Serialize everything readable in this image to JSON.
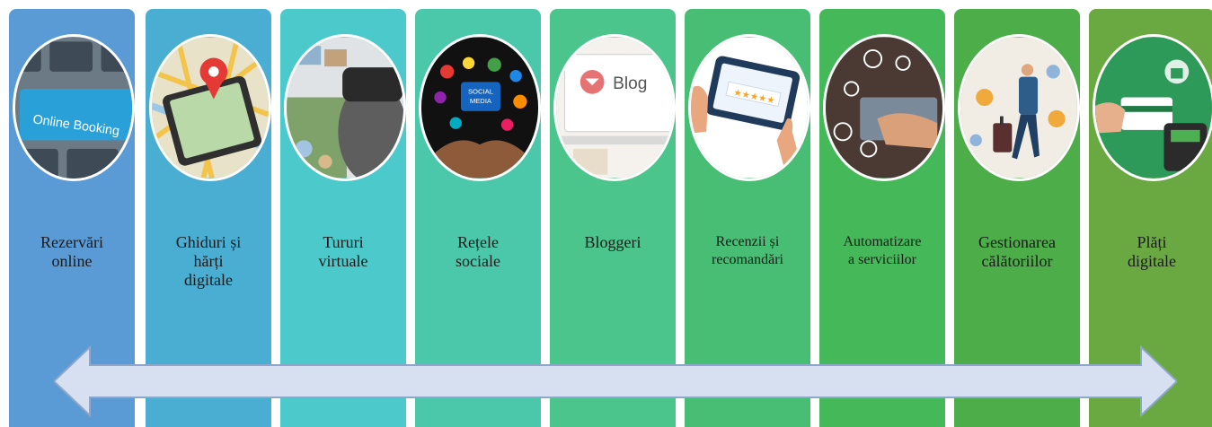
{
  "stages": [
    {
      "label": "Rezervări\nonline",
      "color": "#5b9bd5",
      "icon": "online-booking-keyboard"
    },
    {
      "label": "Ghiduri și\nhărți\ndigitale",
      "color": "#4aaed3",
      "icon": "smartphone-map-pin"
    },
    {
      "label": "Tururi\nvirtuale",
      "color": "#4cc9cb",
      "icon": "vr-headset"
    },
    {
      "label": "Rețele\nsociale",
      "color": "#4ac8a9",
      "icon": "social-media-hands"
    },
    {
      "label": "Bloggeri",
      "color": "#4bc58c",
      "icon": "blog-laptop"
    },
    {
      "label": "Recenzii și\nrecomandări",
      "color": "#48be74",
      "icon": "rating-tablet"
    },
    {
      "label": "Automatizare\na serviciilor",
      "color": "#45b95a",
      "icon": "automation-hands"
    },
    {
      "label": "Gestionarea\ncălătoriilor",
      "color": "#4cad49",
      "icon": "traveler-luggage"
    },
    {
      "label": "Plăți\ndigitale",
      "color": "#6aa842",
      "icon": "digital-payment-card"
    }
  ],
  "booking_key_text": "Online Booking",
  "social_badge_text": "SOCIAL\nMEDIA",
  "blog_text": "Blog",
  "stars_text": "★★★★★",
  "arrow_color": "#d6e0f1"
}
